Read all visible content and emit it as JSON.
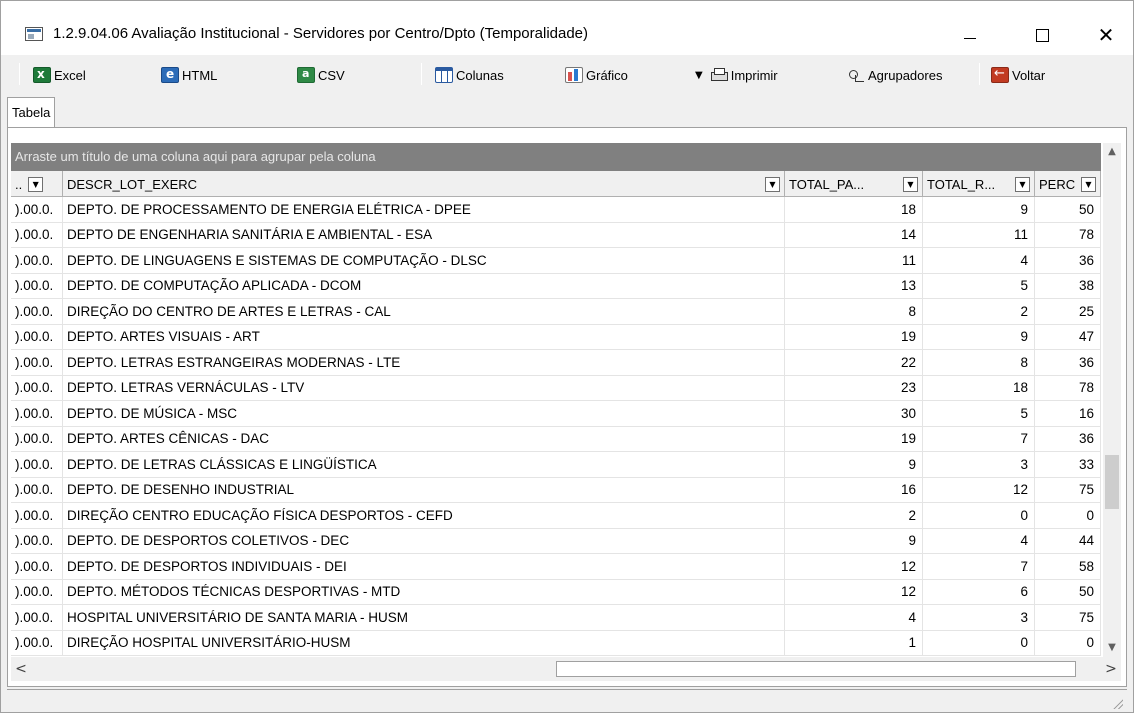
{
  "window": {
    "title": "1.2.9.04.06 Avaliação Institucional - Servidores por Centro/Dpto (Temporalidade)",
    "minimize": "—",
    "maximize": "☐",
    "close": "✕"
  },
  "toolbar": {
    "excel": "Excel",
    "html": "HTML",
    "csv": "CSV",
    "colunas": "Colunas",
    "grafico": "Gráfico",
    "dropdown_arrow": "▼",
    "imprimir": "Imprimir",
    "agrupadores": "Agrupadores",
    "voltar": "Voltar"
  },
  "tabs": [
    {
      "label": "Tabela"
    }
  ],
  "grid": {
    "group_panel_text": "Arraste um título de uma coluna aqui para agrupar pela coluna",
    "columns": {
      "code": "..",
      "desc": "DESCR_LOT_EXERC",
      "total_pa": "TOTAL_PA...",
      "total_r": "TOTAL_R...",
      "perc": "PERC"
    },
    "rows": [
      {
        "code": ").00.0.",
        "desc": "DEPTO. DE PROCESSAMENTO DE ENERGIA ELÉTRICA - DPEE",
        "total_pa": "18",
        "total_r": "9",
        "perc": "50"
      },
      {
        "code": ").00.0.",
        "desc": "DEPTO DE ENGENHARIA SANITÁRIA E AMBIENTAL - ESA",
        "total_pa": "14",
        "total_r": "11",
        "perc": "78"
      },
      {
        "code": ").00.0.",
        "desc": "DEPTO. DE LINGUAGENS E SISTEMAS DE COMPUTAÇÃO - DLSC",
        "total_pa": "11",
        "total_r": "4",
        "perc": "36"
      },
      {
        "code": ").00.0.",
        "desc": "DEPTO. DE COMPUTAÇÃO APLICADA - DCOM",
        "total_pa": "13",
        "total_r": "5",
        "perc": "38"
      },
      {
        "code": ").00.0.",
        "desc": "DIREÇÃO DO CENTRO DE ARTES E LETRAS - CAL",
        "total_pa": "8",
        "total_r": "2",
        "perc": "25"
      },
      {
        "code": ").00.0.",
        "desc": "DEPTO. ARTES VISUAIS - ART",
        "total_pa": "19",
        "total_r": "9",
        "perc": "47"
      },
      {
        "code": ").00.0.",
        "desc": "DEPTO. LETRAS ESTRANGEIRAS MODERNAS - LTE",
        "total_pa": "22",
        "total_r": "8",
        "perc": "36"
      },
      {
        "code": ").00.0.",
        "desc": "DEPTO. LETRAS VERNÁCULAS - LTV",
        "total_pa": "23",
        "total_r": "18",
        "perc": "78"
      },
      {
        "code": ").00.0.",
        "desc": "DEPTO. DE MÚSICA - MSC",
        "total_pa": "30",
        "total_r": "5",
        "perc": "16"
      },
      {
        "code": ").00.0.",
        "desc": "DEPTO. ARTES CÊNICAS - DAC",
        "total_pa": "19",
        "total_r": "7",
        "perc": "36"
      },
      {
        "code": ").00.0.",
        "desc": "DEPTO. DE LETRAS CLÁSSICAS E LINGÜÍSTICA",
        "total_pa": "9",
        "total_r": "3",
        "perc": "33"
      },
      {
        "code": ").00.0.",
        "desc": "DEPTO. DE DESENHO INDUSTRIAL",
        "total_pa": "16",
        "total_r": "12",
        "perc": "75"
      },
      {
        "code": ").00.0.",
        "desc": "DIREÇÃO CENTRO EDUCAÇÃO FÍSICA DESPORTOS - CEFD",
        "total_pa": "2",
        "total_r": "0",
        "perc": "0"
      },
      {
        "code": ").00.0.",
        "desc": "DEPTO. DE DESPORTOS COLETIVOS - DEC",
        "total_pa": "9",
        "total_r": "4",
        "perc": "44"
      },
      {
        "code": ").00.0.",
        "desc": "DEPTO. DE DESPORTOS INDIVIDUAIS - DEI",
        "total_pa": "12",
        "total_r": "7",
        "perc": "58"
      },
      {
        "code": ").00.0.",
        "desc": "DEPTO. MÉTODOS TÉCNICAS DESPORTIVAS - MTD",
        "total_pa": "12",
        "total_r": "6",
        "perc": "50"
      },
      {
        "code": ").00.0.",
        "desc": "HOSPITAL UNIVERSITÁRIO DE SANTA MARIA - HUSM",
        "total_pa": "4",
        "total_r": "3",
        "perc": "75"
      },
      {
        "code": ").00.0.",
        "desc": "DIREÇÃO HOSPITAL UNIVERSITÁRIO-HUSM",
        "total_pa": "1",
        "total_r": "0",
        "perc": "0"
      }
    ]
  },
  "scrollbars": {
    "up": "▲",
    "down": "▼",
    "left": "<",
    "right": ">"
  }
}
